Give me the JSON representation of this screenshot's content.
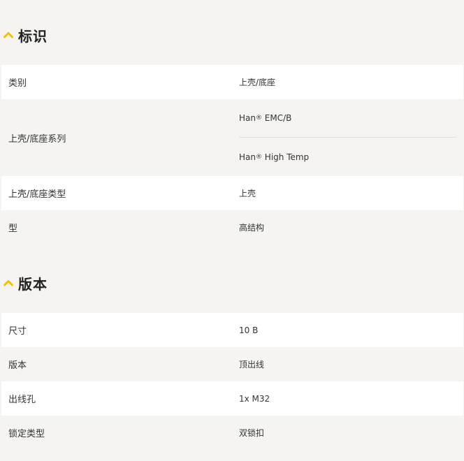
{
  "sections": [
    {
      "title": "标识",
      "rows": [
        {
          "label": "类别",
          "values": [
            "上壳/底座"
          ]
        },
        {
          "label": "上壳/底座系列",
          "values": [
            {
              "text": "Han",
              "sup": "®",
              "rest": " EMC/B"
            },
            {
              "text": "Han",
              "sup": "®",
              "rest": " High Temp"
            }
          ]
        },
        {
          "label": "上壳/底座类型",
          "values": [
            "上壳"
          ]
        },
        {
          "label": "型",
          "values": [
            "高结构"
          ]
        }
      ]
    },
    {
      "title": "版本",
      "rows": [
        {
          "label": "尺寸",
          "values": [
            "10 B"
          ]
        },
        {
          "label": "版本",
          "values": [
            "顶出线"
          ]
        },
        {
          "label": "出线孔",
          "values": [
            "1x M32"
          ]
        },
        {
          "label": "锁定类型",
          "values": [
            "双锁扣"
          ]
        }
      ]
    }
  ],
  "colors": {
    "accent": "#f2c200",
    "row_white": "#ffffff",
    "row_grey": "#f5f4f0"
  },
  "icons": {
    "section_toggle": "chevron-up-icon"
  }
}
